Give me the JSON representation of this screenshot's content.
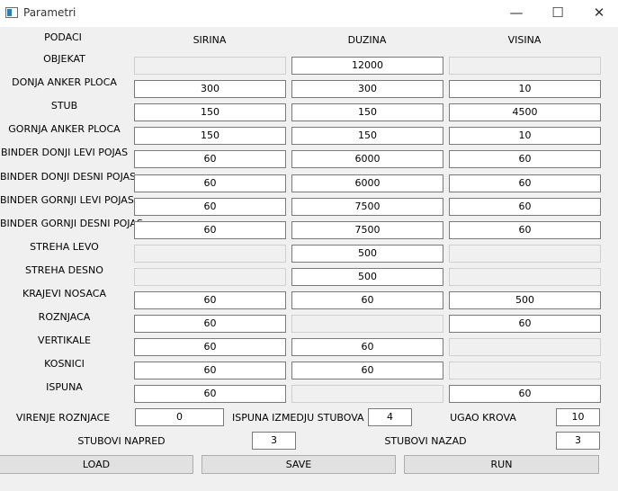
{
  "window": {
    "title": "Parametri",
    "minimize_glyph": "—",
    "maximize_glyph": "☐",
    "close_glyph": "✕"
  },
  "headers": {
    "podaci": "PODACI",
    "sirina": "SIRINA",
    "duzina": "DUZINA",
    "visina": "VISINA"
  },
  "rows": [
    {
      "label": "OBJEKAT",
      "sirina": "",
      "duzina": "12000",
      "visina": ""
    },
    {
      "label": "DONJA ANKER PLOCA",
      "sirina": "300",
      "duzina": "300",
      "visina": "10"
    },
    {
      "label": "STUB",
      "sirina": "150",
      "duzina": "150",
      "visina": "4500"
    },
    {
      "label": "GORNJA ANKER PLOCA",
      "sirina": "150",
      "duzina": "150",
      "visina": "10"
    },
    {
      "label": "BINDER DONJI LEVI POJAS",
      "sirina": "60",
      "duzina": "6000",
      "visina": "60"
    },
    {
      "label": "BINDER DONJI DESNI POJAS",
      "sirina": "60",
      "duzina": "6000",
      "visina": "60"
    },
    {
      "label": "BINDER GORNJI LEVI POJAS",
      "sirina": "60",
      "duzina": "7500",
      "visina": "60"
    },
    {
      "label": "BINDER GORNJI DESNI POJAS",
      "sirina": "60",
      "duzina": "7500",
      "visina": "60"
    },
    {
      "label": "STREHA LEVO",
      "sirina": "",
      "duzina": "500",
      "visina": ""
    },
    {
      "label": "STREHA DESNO",
      "sirina": "",
      "duzina": "500",
      "visina": ""
    },
    {
      "label": "KRAJEVI NOSACA",
      "sirina": "60",
      "duzina": "60",
      "visina": "500"
    },
    {
      "label": "ROZNJACA",
      "sirina": "60",
      "duzina": "",
      "visina": "60"
    },
    {
      "label": "VERTIKALE",
      "sirina": "60",
      "duzina": "60",
      "visina": ""
    },
    {
      "label": "KOSNICI",
      "sirina": "60",
      "duzina": "60",
      "visina": ""
    },
    {
      "label": "ISPUNA",
      "sirina": "60",
      "duzina": "",
      "visina": "60"
    }
  ],
  "extra": {
    "virenje_label": "VIRENJE ROZNJACE",
    "virenje_value": "0",
    "ispuna_stubova_label": "ISPUNA IZMEDJU STUBOVA",
    "ispuna_stubova_value": "4",
    "ugao_label": "UGAO KROVA",
    "ugao_value": "10",
    "napred_label": "STUBOVI NAPRED",
    "napred_value": "3",
    "nazad_label": "STUBOVI NAZAD",
    "nazad_value": "3"
  },
  "buttons": {
    "load": "LOAD",
    "save": "SAVE",
    "run": "RUN"
  }
}
